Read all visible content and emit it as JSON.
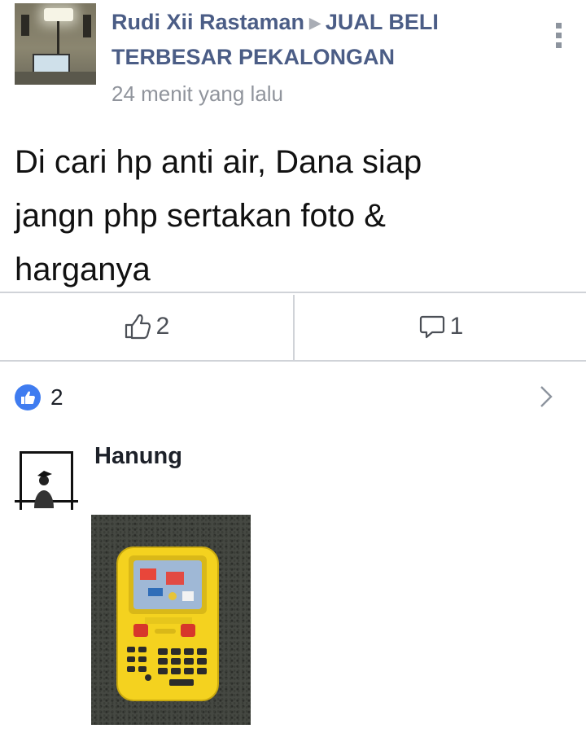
{
  "post": {
    "author": "Rudi Xii Rastaman",
    "group": "JUAL BELI TERBESAR PEKALONGAN",
    "timestamp": "24 menit yang lalu",
    "text_lines": [
      "Di cari hp anti air, Dana siap",
      "jangn php sertakan foto &",
      "harganya"
    ]
  },
  "actions": {
    "like_count": "2",
    "comment_count": "1"
  },
  "reactions": {
    "count": "2"
  },
  "comment": {
    "author": "Hanung"
  },
  "colors": {
    "link": "#4b5d86",
    "muted": "#90949c",
    "like_blue": "#3f7cf0",
    "divider": "#d0d3d8",
    "phone_yellow": "#f4d21f"
  },
  "icons": [
    "more-vertical-icon",
    "thumbs-up-icon",
    "comment-icon",
    "like-badge-icon",
    "chevron-right-icon"
  ]
}
